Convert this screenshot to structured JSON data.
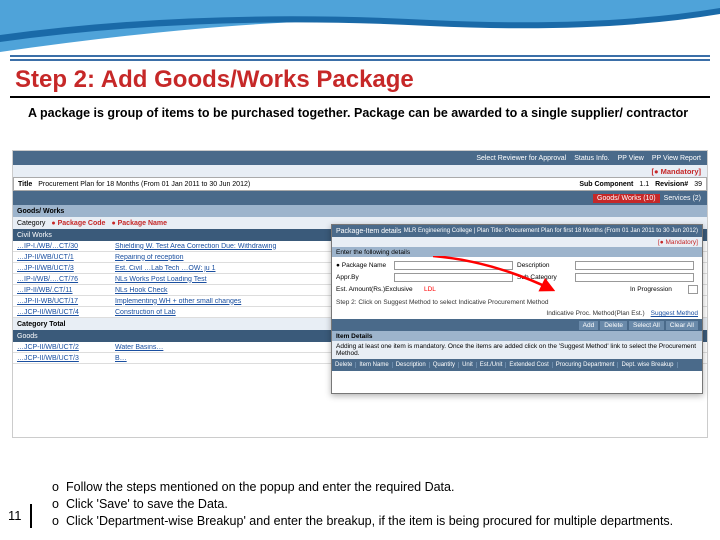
{
  "slide": {
    "title": "Step 2: Add Goods/Works Package",
    "subtitle": "A package is group of items to be purchased together. Package can be awarded to a single supplier/ contractor",
    "page_number": "11",
    "instructions": [
      "Follow the steps mentioned on the popup and enter the required Data.",
      "Click 'Save' to save the Data.",
      "Click 'Department-wise Breakup' and enter the breakup, if the item is being procured for multiple departments."
    ]
  },
  "toolbar": {
    "select_reviewer": "Select Reviewer for Approval",
    "status_info": "Status Info.",
    "pp_view": "PP View",
    "pp_view_report": "PP View Report"
  },
  "mandatory_label": "[● Mandatory]",
  "plan_title_row": {
    "title_label": "Title",
    "title_value": "Procurement Plan for 18 Months (From 01 Jan 2011 to 30 Jun 2012)",
    "sub_component_label": "Sub Component",
    "sub_component_value": "1.1",
    "revision_label": "Revision#",
    "revision_value": "39"
  },
  "gw_header": {
    "label": "Goods/ Works (10)",
    "services": "Services (2)"
  },
  "goods_works_section": "Goods/ Works",
  "category_row": {
    "category_label": "Category",
    "pkg_code_label": "● Package Code",
    "pkg_name_label": "● Package Name"
  },
  "civil_works": "Civil Works",
  "packages": [
    {
      "code": "…IP-I./WB/…CT/30",
      "name": "Shielding W. Test Area Correction Due: Withdrawing"
    },
    {
      "code": "…JP-II/WB/UCT/1",
      "name": "Repairing of reception"
    },
    {
      "code": "…JP-II/WB/UCT/3",
      "name": "Est. Civil …Lab Tech …OW: ju 1"
    },
    {
      "code": "…IP-I/WB/.…CT/76",
      "name": "NLs Works Post Loading Test"
    },
    {
      "code": "…IP-II/WB/.CT/11",
      "name": "NLs Hook Check"
    },
    {
      "code": "…JP-II-WB/UCT/17",
      "name": "Implementing WH + other small changes"
    },
    {
      "code": "…JCP-II/WB/UCT/4",
      "name": "Construction of Lab"
    }
  ],
  "category_total": "Category Total",
  "goods_cat": "Goods",
  "goods_packages": [
    {
      "code": "…JCP-II/WB/UCT/2",
      "name": "Water Basins…"
    },
    {
      "code": "…JCP-II/WB/UCT/3",
      "name": "B…"
    }
  ],
  "popup": {
    "header": "Package-Item details",
    "context": "MLR Engineering College | Plan Title: Procurement Plan for first 18 Months (From 01 Jan 2011 to 30 Jun 2012)",
    "mandatory": "[● Mandatory]",
    "enter_following": "Enter the following details",
    "form": {
      "package_name_label": "● Package Name",
      "description_label": "Description",
      "approx_by_label": "Appr.By",
      "sub_category_label": "Sub Category",
      "est_amt_label": "Est. Amount(Rs.)Exclusive",
      "est_amt_hint": "LDL",
      "in_progression_label": "In Progression"
    },
    "step2_note": "Step 2: Click on Suggest Method to select Indicative Procurement Method",
    "indicative_label": "Indicative Proc. Method(Plan Est.)",
    "suggest_method": "Suggest Method",
    "buttons": {
      "add": "Add",
      "delete": "Delete",
      "select_all": "Select All",
      "clear_all": "Clear All"
    },
    "item_details": "Item Details",
    "item_instr": "Adding at least one item is mandatory. Once the items are added click on the 'Suggest Method' link to select the Procurement Method.",
    "item_cols": [
      "Delete",
      "Item Name",
      "Description",
      "Quantity",
      "Unit",
      "Est./Unit",
      "Extended Cost",
      "Procuring Department",
      "Dept. wise Breakup"
    ]
  }
}
